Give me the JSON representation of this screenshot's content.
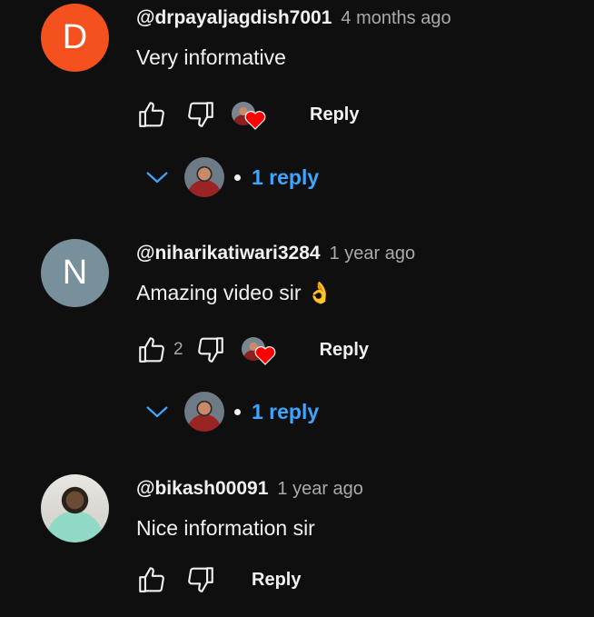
{
  "comments": [
    {
      "avatar_letter": "D",
      "avatar_color": "#f4511e",
      "author": "@drpayaljagdish7001",
      "time": "4 months ago",
      "text": "Very informative",
      "like_count": "",
      "reply_label": "Reply",
      "replies_label": "1 reply"
    },
    {
      "avatar_letter": "N",
      "avatar_color": "#78909c",
      "author": "@niharikatiwari3284",
      "time": "1 year ago",
      "text": "Amazing video sir 👌",
      "like_count": "2",
      "reply_label": "Reply",
      "replies_label": "1 reply"
    },
    {
      "avatar_letter": "",
      "avatar_color": "",
      "author": "@bikash00091",
      "time": "1 year ago",
      "text": "Nice information sir",
      "like_count": "",
      "reply_label": "Reply"
    }
  ],
  "colors": {
    "background": "#0f0f0f",
    "link": "#3ea6ff",
    "heart": "#ff0000"
  },
  "icons": {
    "like": "thumb-up-icon",
    "dislike": "thumb-down-icon",
    "creator_heart": "heart-icon",
    "expand": "chevron-down-icon"
  }
}
